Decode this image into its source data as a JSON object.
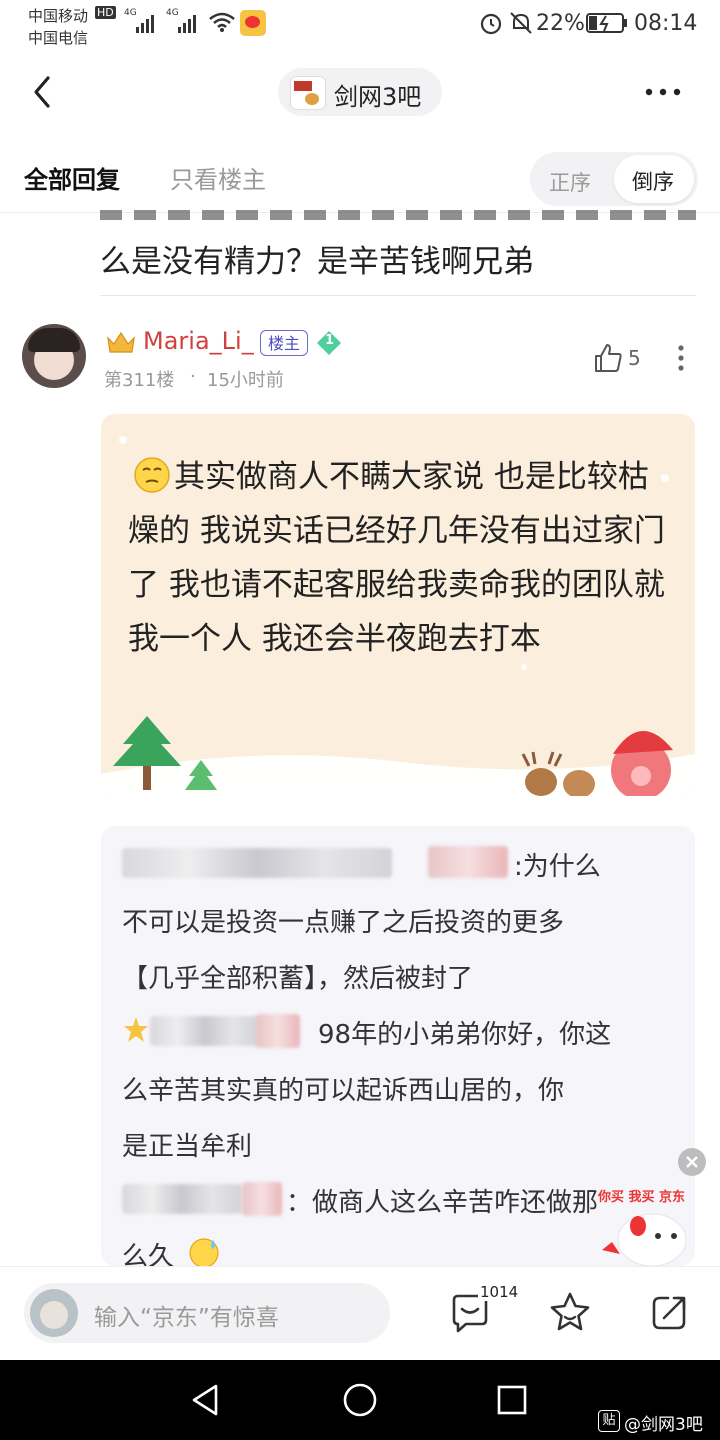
{
  "status_bar": {
    "carrier1": "中国移动",
    "carrier1_badge": "HD",
    "carrier2": "中国电信",
    "net1": "4G",
    "net2": "4G",
    "battery_percent": "22%",
    "time": "08:14"
  },
  "nav": {
    "forum_name": "剑网3吧",
    "back_icon": "chevron-left-icon",
    "more_icon": "more-horizontal-icon"
  },
  "tabs": {
    "all_replies": "全部回复",
    "op_only": "只看楼主",
    "sort_asc": "正序",
    "sort_desc": "倒序"
  },
  "prev_quote_tail": "么是没有精力？是辛苦钱啊兄弟",
  "floor": {
    "username": "Maria_Li_",
    "op_badge": "楼主",
    "level": "1",
    "floor_no": "第311楼",
    "separator": "·",
    "time_ago": "15小时前",
    "likes": "5",
    "post_text": "其实做商人不瞒大家说 也是比较枯燥的 我说实话已经好几年没有出过家门了 我也请不起客服给我卖命我的团队就我一个人 我还会半夜跑去打本"
  },
  "replies": [
    {
      "text": ":为什么"
    },
    {
      "text": "不可以是投资一点赚了之后投资的更多"
    },
    {
      "text": "【几乎全部积蓄】，然后被封了"
    },
    {
      "text": "98年的小弟弟你好，你这"
    },
    {
      "text": "么辛苦其实真的可以起诉西山居的，你"
    },
    {
      "text": "是正当牟利"
    },
    {
      "text": "：做商人这么辛苦咋还做那"
    },
    {
      "text": "么久"
    }
  ],
  "ad": {
    "text": "你买 我买 京东"
  },
  "bottom_bar": {
    "input_placeholder": "输入“京东”有惊喜",
    "comment_count": "1014"
  },
  "watermark": "@剑网3吧",
  "colors": {
    "username": "#d23f3f",
    "op_badge": "#4d4cc1",
    "post_bg": "#fbeedd",
    "reply_bg": "#f5f5fa"
  }
}
